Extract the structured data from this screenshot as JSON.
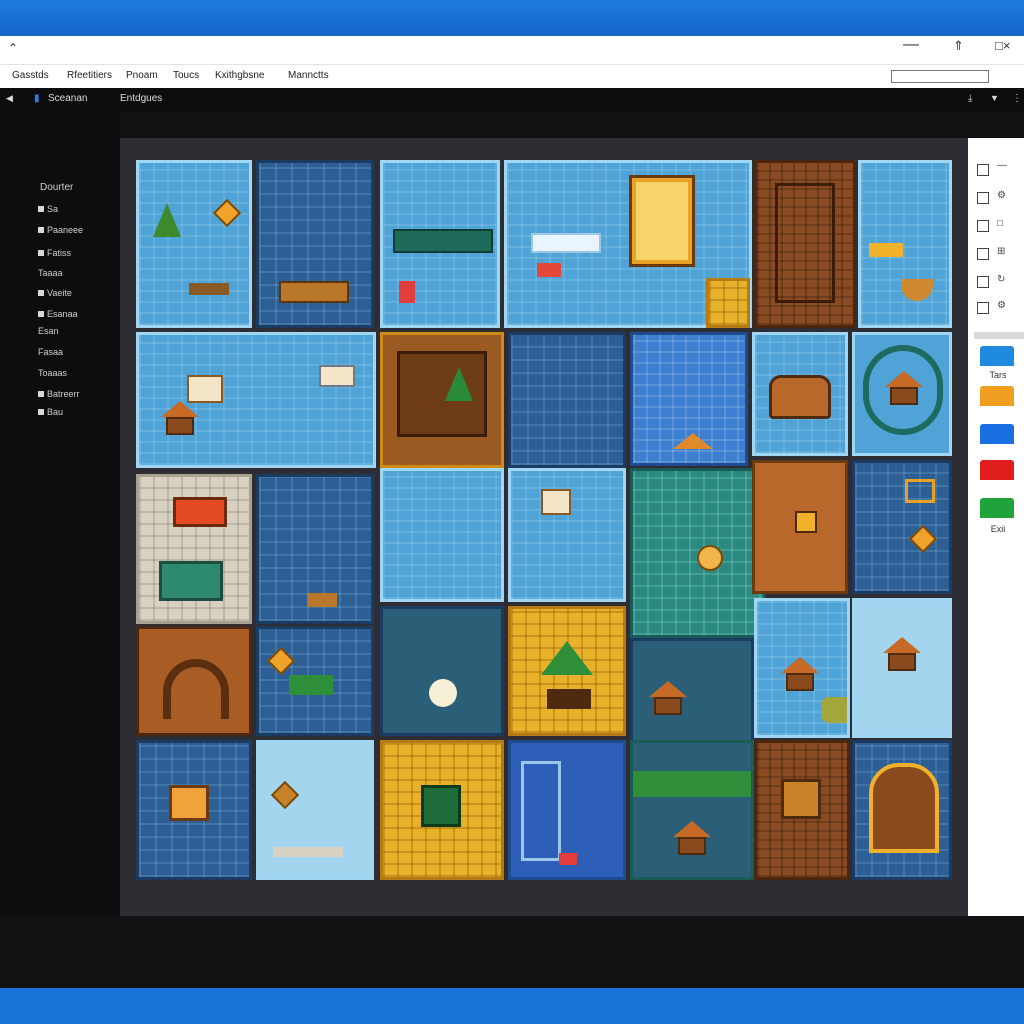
{
  "window": {
    "menus": [
      "Gasstds",
      "Rfeetitiers",
      "Pnoam",
      "Toucs",
      "Kxithgbsne",
      "Mannctts"
    ],
    "toolbar_label_1": "Sceanan",
    "toolbar_label_2": "Entdgues"
  },
  "sidebar": {
    "header": "Dourter",
    "items": [
      {
        "label": "Sa",
        "icon": "pointer-icon"
      },
      {
        "label": "Paaneee",
        "icon": "arrow-icon"
      },
      {
        "label": "Fatiss",
        "icon": "tile-icon"
      },
      {
        "label": "Taaaa",
        "icon": ""
      },
      {
        "label": "Vaeite",
        "icon": "layer-icon"
      },
      {
        "label": "Esanaa",
        "icon": "folder-icon"
      },
      {
        "label": "Esan",
        "icon": ""
      },
      {
        "label": "Fasaa",
        "icon": ""
      },
      {
        "label": "Toaaas",
        "icon": ""
      },
      {
        "label": "Batreerr",
        "icon": "save-icon"
      },
      {
        "label": "Bau",
        "icon": "play-icon"
      }
    ]
  },
  "right_panel": {
    "swatch_label_1": "Tars",
    "swatch_label_2": "Exii",
    "swatch_colors": [
      "#1f8ae0",
      "#f0a020",
      "#1a6fe0",
      "#e01e1e",
      "#1fa33a"
    ]
  },
  "map": {
    "grid_cols": 7,
    "grid_rows": 5
  }
}
